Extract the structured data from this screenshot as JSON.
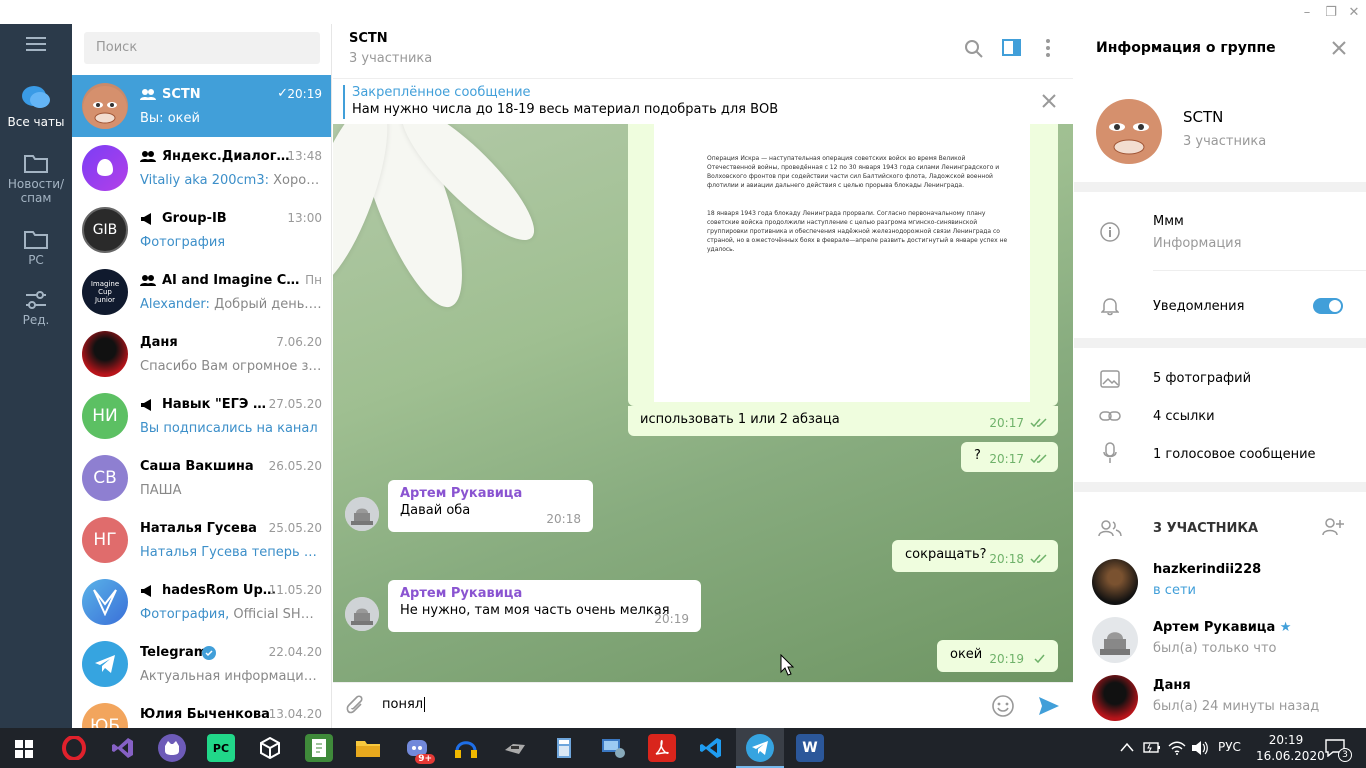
{
  "window": {
    "min": "–",
    "max": "❐",
    "close": "✕"
  },
  "folders": [
    {
      "label": "Все чаты"
    },
    {
      "label": "Новости/\nспам"
    },
    {
      "label": "PC"
    },
    {
      "label": "Ред."
    }
  ],
  "search": {
    "placeholder": "Поиск"
  },
  "chats": [
    {
      "name": "SCTN",
      "time": "20:19",
      "msg": "Вы: окей",
      "icon": "group-icon",
      "check": "✓"
    },
    {
      "name": "Яндекс.Диалоги (...",
      "time": "13:48",
      "sender": "Vitaliy aka 200cm3:",
      "msg": "Хорошо ...",
      "icon": "group-icon"
    },
    {
      "name": "Group-IB",
      "time": "13:00",
      "msg": "Фотография",
      "hl": true,
      "icon": "channel-icon",
      "avtext": "GIB"
    },
    {
      "name": "AI and Imagine Cup ...",
      "time": "Пн",
      "sender": "Alexander:",
      "msg": "Добрый день. Кт...",
      "icon": "group-icon",
      "avtext": "Imagine Cup Junior"
    },
    {
      "name": "Даня",
      "time": "7.06.20",
      "msg": "Спасибо Вам огромное за ..."
    },
    {
      "name": "Навык \"ЕГЭ по...",
      "time": "27.05.20",
      "msg": "Вы подписались на канал",
      "hl": true,
      "icon": "channel-icon",
      "avtext": "НИ"
    },
    {
      "name": "Саша Вакшина",
      "time": "26.05.20",
      "msg": "ПАША",
      "avtext": "СВ"
    },
    {
      "name": "Наталья Гусева",
      "time": "25.05.20",
      "msg": "Наталья Гусева теперь в Tel...",
      "hl": true,
      "avtext": "НГ"
    },
    {
      "name": "hadesRom Upd...",
      "time": "11.05.20",
      "sender": "Фотография,",
      "msg": "Official SHRP o...",
      "icon": "channel-icon"
    },
    {
      "name": "Telegram",
      "time": "22.04.20",
      "msg": "Актуальная информация о ...",
      "verified": true
    },
    {
      "name": "Юлия Быченкова",
      "time": "13.04.20",
      "msg": "",
      "avtext": "ЮБ"
    }
  ],
  "header": {
    "title": "SCTN",
    "subtitle": "3 участника"
  },
  "pinned": {
    "title": "Закреплённое сообщение",
    "text": "Нам нужно числа до 18-19 весь материал подобрать для ВОВ"
  },
  "document": {
    "p1": "Операция Искра — наступательная операция советских войск во время Великой Отечественной войны, проведённая с 12 по 30 января 1943 года силами Ленинградского и Волховского фронтов при содействии части сил Балтийского флота, Ладожской военной флотилии и авиации дальнего действия с целью прорыва блокады Ленинграда.",
    "p2": "18 января 1943 года блокаду Ленинграда прорвали. Согласно первоначальному плану советские войска продолжили наступление с целью разгрома мгинско-синявинской группировки противника и обеспечения надёжной железнодорожной связи Ленинграда со страной, но в ожесточённых боях в феврале—апреле развить достигнутый в январе успех не удалось."
  },
  "messages": [
    {
      "type": "out",
      "text": "использовать 1 или 2 абзаца",
      "time": "20:17"
    },
    {
      "type": "out",
      "text": "?",
      "time": "20:17"
    },
    {
      "type": "in",
      "sender": "Артем Рукавица",
      "text": "Давай оба",
      "time": "20:18"
    },
    {
      "type": "out",
      "text": "сокращать?",
      "time": "20:18"
    },
    {
      "type": "in",
      "sender": "Артем Рукавица",
      "text": "Не нужно, там моя часть очень мелкая",
      "time": "20:19"
    },
    {
      "type": "out",
      "text": "окей",
      "time": "20:19"
    }
  ],
  "composer": {
    "value": "понял"
  },
  "info": {
    "title": "Информация о группе",
    "name": "SCTN",
    "subtitle": "3 участника",
    "desc": "Ммм",
    "desc_label": "Информация",
    "notif": "Уведомления",
    "notif_on": true,
    "media": [
      "5 фотографий",
      "4 ссылки",
      "1 голосовое сообщение"
    ],
    "members_title": "3 УЧАСТНИКА",
    "members": [
      {
        "name": "hazkerindii228",
        "status": "в сети",
        "online": true
      },
      {
        "name": "Артем Рукавица",
        "status": "был(а) только что",
        "star": "★"
      },
      {
        "name": "Даня",
        "status": "был(а) 24 минуты назад"
      }
    ]
  },
  "taskbar": {
    "lang": "РУС",
    "time": "20:19",
    "date": "16.06.2020",
    "badge": "9+",
    "notif": "3"
  },
  "colors": {
    "accent": "#419fd9",
    "sidebar": "#2b3a4a",
    "out_bubble": "#effdde"
  }
}
